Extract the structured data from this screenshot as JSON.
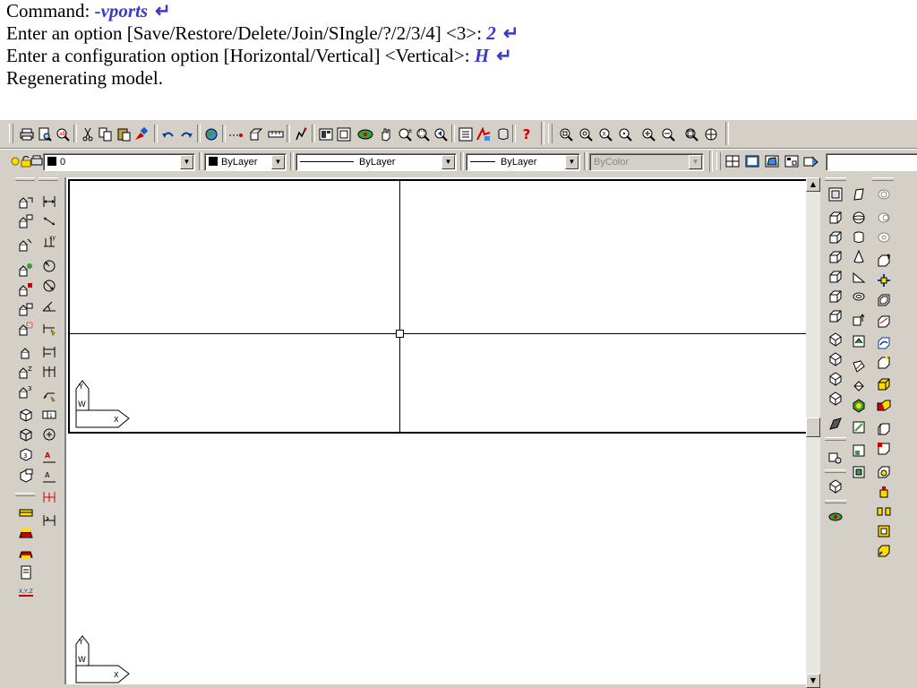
{
  "command_history": {
    "line1_prompt": "Command: ",
    "line1_typed": "-vports",
    "line2_prompt": "Enter an option [Save/Restore/Delete/Join/SIngle/?/2/3/4] <3>: ",
    "line2_typed": "2",
    "line3_prompt": "Enter a configuration option [Horizontal/Vertical] <Vertical>: ",
    "line3_typed": "H",
    "line4_text": "Regenerating model.",
    "enter_symbol": "↵"
  },
  "properties_toolbar": {
    "layer_value": "0",
    "color_value": "ByLayer",
    "linetype_value": "ByLayer",
    "lineweight_value": "ByLayer",
    "plotstyle_value": "ByColor"
  },
  "icons": {
    "standard_toolbar": [
      "print-icon",
      "print-preview-icon",
      "find-replace-icon",
      "cut-icon",
      "copy-icon",
      "paste-icon",
      "match-properties-icon",
      "undo-icon",
      "redo-icon",
      "internet-icon",
      "snap-icon",
      "tracking-icon",
      "ortho-icon",
      "ucs-icon",
      "aerial-view-icon",
      "named-views-icon",
      "3d-orbit-icon",
      "pan-icon",
      "zoom-realtime-icon",
      "zoom-window-icon",
      "zoom-previous-icon",
      "properties-icon",
      "design-center-icon",
      "database-icon",
      "help-icon"
    ],
    "zoom_toolbar": [
      "zoom-window-icon",
      "zoom-dynamic-icon",
      "zoom-scale-icon",
      "zoom-center-icon",
      "zoom-in-icon",
      "zoom-out-icon",
      "zoom-all-icon",
      "zoom-extents-icon"
    ]
  },
  "colors": {
    "chrome": "#d4d0c8",
    "typed_command": "#3a3ac8",
    "canvas": "#ffffff"
  }
}
